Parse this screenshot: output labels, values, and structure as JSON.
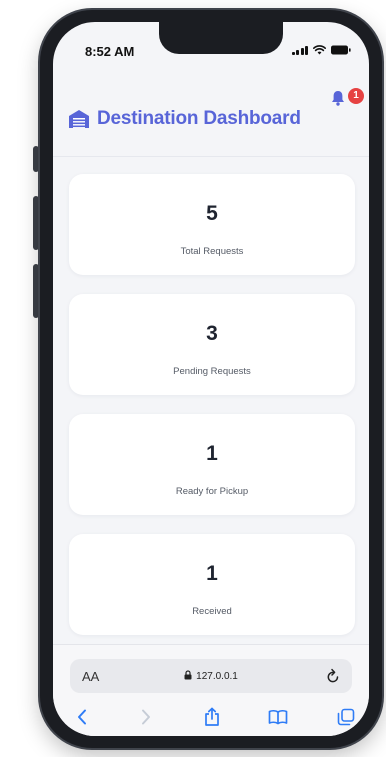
{
  "status_bar": {
    "time": "8:52 AM"
  },
  "header": {
    "title": "Destination Dashboard",
    "title_icon": "warehouse-icon",
    "notification_icon": "bell-icon",
    "notification_count": "1"
  },
  "stats": [
    {
      "value": "5",
      "label": "Total Requests"
    },
    {
      "value": "3",
      "label": "Pending Requests"
    },
    {
      "value": "1",
      "label": "Ready for Pickup"
    },
    {
      "value": "1",
      "label": "Received"
    }
  ],
  "browser": {
    "aa_label": "AA",
    "url": "127.0.0.1",
    "nav_icons": [
      "back-icon",
      "forward-icon",
      "share-icon",
      "bookmarks-icon",
      "tabs-icon"
    ]
  },
  "colors": {
    "accent": "#5865d8",
    "badge": "#e64242",
    "safari_blue": "#2f7cf6"
  }
}
